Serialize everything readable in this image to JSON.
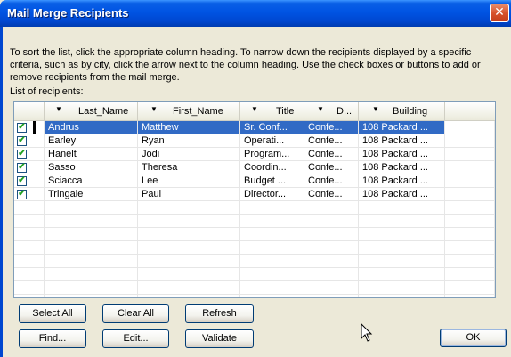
{
  "window": {
    "title": "Mail Merge Recipients",
    "close_glyph": "✕"
  },
  "instructions": "To sort the list, click the appropriate column heading.  To narrow down the recipients displayed by a specific criteria, such as by city, click the arrow next to the column heading.  Use the check boxes or buttons to add or remove recipients from the mail merge.",
  "list_label": "List of recipients:",
  "columns": [
    "Last_Name",
    "First_Name",
    "Title",
    "D...",
    "Building"
  ],
  "dropdown_glyph": "▼",
  "check_glyph": "✔",
  "rows": [
    {
      "checked": true,
      "selected": true,
      "cells": [
        "Andrus",
        "Matthew",
        "Sr. Conf...",
        "Confe...",
        "108 Packard ..."
      ]
    },
    {
      "checked": true,
      "selected": false,
      "cells": [
        "Earley",
        "Ryan",
        "Operati...",
        "Confe...",
        "108 Packard ..."
      ]
    },
    {
      "checked": true,
      "selected": false,
      "cells": [
        "Hanelt",
        "Jodi",
        "Program...",
        "Confe...",
        "108 Packard ..."
      ]
    },
    {
      "checked": true,
      "selected": false,
      "cells": [
        "Sasso",
        "Theresa",
        "Coordin...",
        "Confe...",
        "108 Packard ..."
      ]
    },
    {
      "checked": true,
      "selected": false,
      "cells": [
        "Sciacca",
        "Lee",
        "Budget ...",
        "Confe...",
        "108 Packard ..."
      ]
    },
    {
      "checked": true,
      "selected": false,
      "cells": [
        "Tringale",
        "Paul",
        "Director...",
        "Confe...",
        "108 Packard ..."
      ]
    }
  ],
  "buttons": {
    "select_all": "Select All",
    "clear_all": "Clear All",
    "refresh": "Refresh",
    "find": "Find...",
    "edit": "Edit...",
    "validate": "Validate",
    "ok": "OK"
  },
  "icons": {
    "close": "close-icon",
    "dropdown": "dropdown-arrow-icon",
    "checkbox": "checkbox-icon",
    "cursor": "mouse-cursor-icon"
  },
  "colors": {
    "titlebar": "#0054e3",
    "selection": "#316ac5",
    "dialog": "#ece9d8",
    "check": "#21a121"
  }
}
